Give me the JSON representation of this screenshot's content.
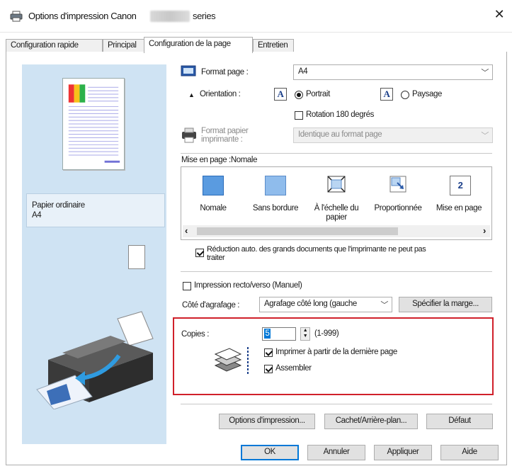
{
  "window": {
    "title_prefix": "Options d'impression Canon",
    "title_suffix": "series",
    "close_glyph": "✕"
  },
  "tabs": [
    {
      "label": "Configuration rapide"
    },
    {
      "label": "Principal"
    },
    {
      "label": "Configuration de la page",
      "active": true
    },
    {
      "label": "Entretien"
    }
  ],
  "preview": {
    "paper_type": "Papier ordinaire",
    "paper_size": "A4"
  },
  "page_setup": {
    "page_size_label": "Format page :",
    "page_size_value": "A4",
    "orientation_label": "Orientation :",
    "portrait_label": "Portrait",
    "portrait_selected": true,
    "landscape_label": "Paysage",
    "landscape_selected": false,
    "rotate180_label": "Rotation 180 degrés",
    "rotate180_checked": false,
    "printer_paper_label_1": "Format papier",
    "printer_paper_label_2": "imprimante :",
    "printer_paper_value": "Identique au format page",
    "a_glyph": "A"
  },
  "layout": {
    "heading": "Mise en page :Nomale",
    "options": [
      {
        "label_1": "Nomale",
        "label_2": "",
        "selected": true,
        "icon": "normal-layout-icon"
      },
      {
        "label_1": "Sans bordure",
        "label_2": "",
        "selected": false,
        "icon": "borderless-layout-icon"
      },
      {
        "label_1": "À l'échelle du",
        "label_2": "papier",
        "selected": false,
        "icon": "fit-to-paper-icon"
      },
      {
        "label_1": "Proportionnée",
        "label_2": "",
        "selected": false,
        "icon": "scaled-layout-icon"
      },
      {
        "label_1": "Mise en page",
        "label_2": "",
        "selected": false,
        "icon": "page-layout-icon"
      }
    ],
    "page_layout_number": "2",
    "scroll_left": "‹",
    "scroll_right": "›",
    "auto_reduce_line1": "Réduction auto. des grands documents que l'imprimante ne peut pas",
    "auto_reduce_line2": "traiter",
    "auto_reduce_checked": true
  },
  "duplex": {
    "label": "Impression recto/verso (Manuel)",
    "checked": false,
    "staple_label": "Côté d'agrafage :",
    "staple_value": "Agrafage côté long (gauche",
    "margin_button": "Spécifier la marge..."
  },
  "copies": {
    "label": "Copies :",
    "value": "5",
    "range": "(1-999)",
    "reverse_label": "Imprimer à partir de la dernière page",
    "reverse_checked": true,
    "collate_label": "Assembler",
    "collate_checked": true
  },
  "bottom_buttons": {
    "print_options": "Options d'impression...",
    "stamp_background": "Cachet/Arrière-plan...",
    "defaults": "Défaut"
  },
  "dialog_buttons": {
    "ok": "OK",
    "cancel": "Annuler",
    "apply": "Appliquer",
    "help": "Aide"
  },
  "colors": {
    "preview_bg": "#cfe3f3",
    "accent": "#0078d7",
    "highlight_border": "#d0202a"
  }
}
